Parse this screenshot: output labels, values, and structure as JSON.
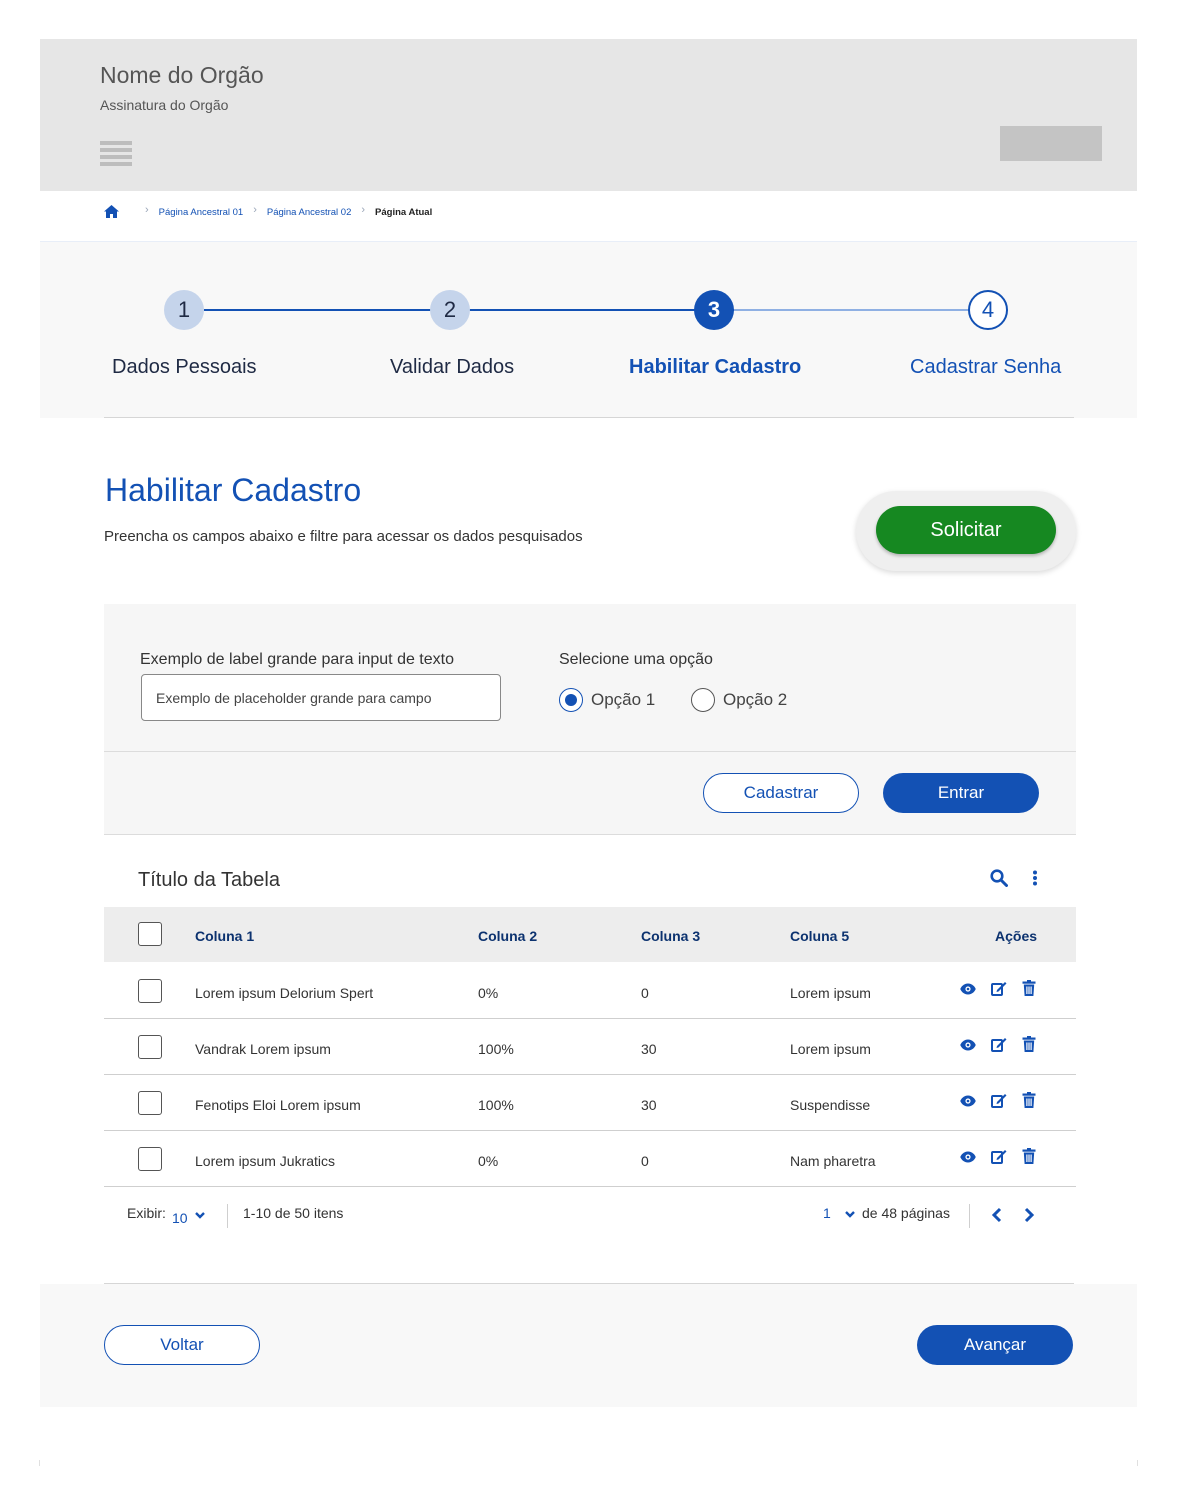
{
  "header": {
    "org_name": "Nome do Orgão",
    "org_signature": "Assinatura do Orgão"
  },
  "breadcrumb": {
    "items": [
      "Página Ancestral 01",
      "Página Ancestral 02"
    ],
    "current": "Página Atual"
  },
  "stepper": {
    "steps": [
      {
        "number": "1",
        "label": "Dados Pessoais",
        "state": "done"
      },
      {
        "number": "2",
        "label": "Validar Dados",
        "state": "done"
      },
      {
        "number": "3",
        "label": "Habilitar Cadastro",
        "state": "active"
      },
      {
        "number": "4",
        "label": "Cadastrar Senha",
        "state": "pending"
      }
    ]
  },
  "page": {
    "title": "Habilitar Cadastro",
    "subtitle": "Preencha os campos abaixo e filtre para acessar os dados pesquisados",
    "solicitar_label": "Solicitar"
  },
  "form": {
    "text_label": "Exemplo de label grande para input de texto",
    "text_placeholder": "Exemplo de placeholder grande para campo",
    "text_value": "",
    "radio_label": "Selecione uma opção",
    "options": [
      "Opção 1",
      "Opção 2"
    ],
    "selected_option": "Opção 1",
    "cadastrar_label": "Cadastrar",
    "entrar_label": "Entrar"
  },
  "table": {
    "title": "Título da Tabela",
    "columns": [
      "Coluna 1",
      "Coluna 2",
      "Coluna 3",
      "Coluna 5",
      "Ações"
    ],
    "rows": [
      [
        "Lorem ipsum Delorium Spert",
        "0%",
        "0",
        "Lorem ipsum"
      ],
      [
        "Vandrak Lorem ipsum",
        "100%",
        "30",
        "Lorem ipsum"
      ],
      [
        "Fenotips Eloi Lorem ipsum",
        "100%",
        "30",
        "Suspendisse"
      ],
      [
        "Lorem ipsum Jukratics",
        "0%",
        "0",
        "Nam pharetra"
      ]
    ]
  },
  "pagination": {
    "show_label": "Exibir:",
    "show_value": "10",
    "range_text": "1-10 de 50 itens",
    "current_page": "1",
    "pages_text": "de 48 páginas"
  },
  "footer": {
    "back_label": "Voltar",
    "next_label": "Avançar"
  },
  "colors": {
    "primary": "#1351b4",
    "primary_dark": "#0c326f",
    "success": "#168821",
    "step_done": "#c5d4eb"
  },
  "icons": [
    "home-icon",
    "chevron-right-icon",
    "search-icon",
    "more-vertical-icon",
    "eye-icon",
    "edit-icon",
    "trash-icon",
    "chevron-down-icon",
    "chevron-left-icon"
  ]
}
